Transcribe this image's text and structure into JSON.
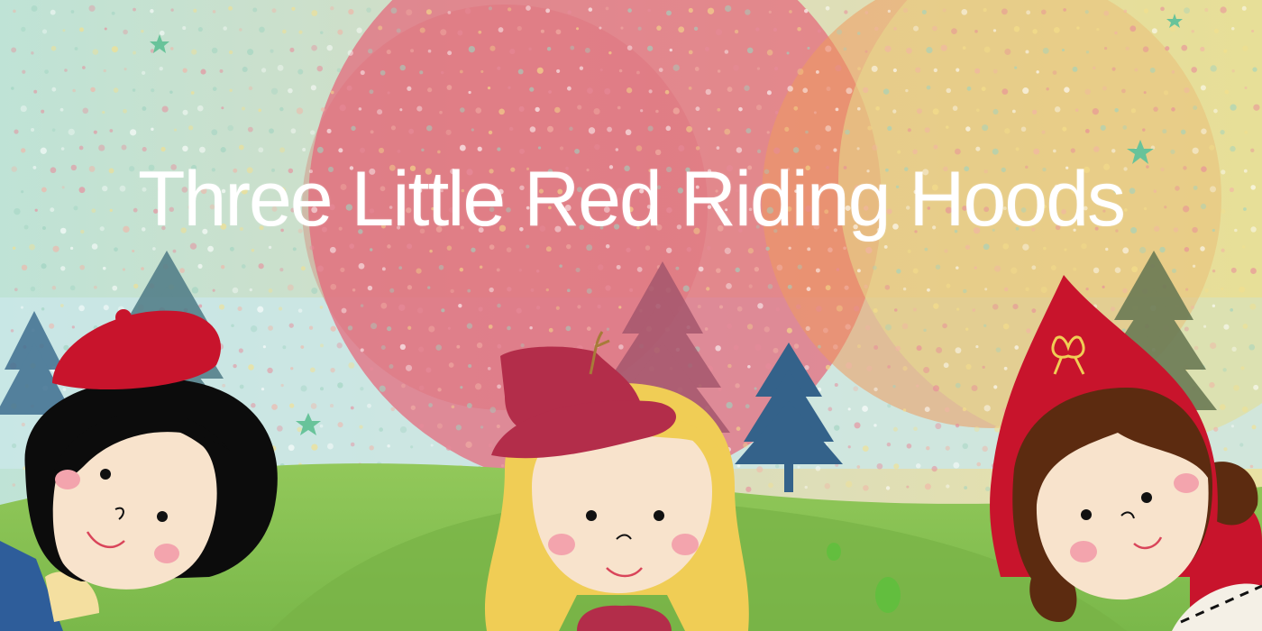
{
  "banner": {
    "title": "Three Little Red Riding Hoods"
  },
  "palette": {
    "sky_left": "#bfe3d6",
    "sky_right": "#e9e2a4",
    "circle_red": "#e4667a",
    "circle_orange": "#ef9a5e",
    "hill_green": "#8cc152",
    "hood_red": "#c8142c",
    "hat_crimson": "#b32d4a",
    "hair_black": "#0c0c0c",
    "hair_blonde": "#f0cd55",
    "hair_brown": "#5c2b10",
    "skin": "#f8e3cc",
    "cheek": "#f3a4ad",
    "tree_blue": "#3f6f90",
    "tree_olive": "#6b7a55",
    "tree_mauve": "#a5576d"
  },
  "characters": [
    {
      "name": "girl-black-hair",
      "icon": "girl-with-red-beret-icon"
    },
    {
      "name": "girl-blonde-hair",
      "icon": "girl-with-crimson-hat-icon"
    },
    {
      "name": "girl-brown-hair",
      "icon": "girl-with-red-hood-icon"
    }
  ]
}
